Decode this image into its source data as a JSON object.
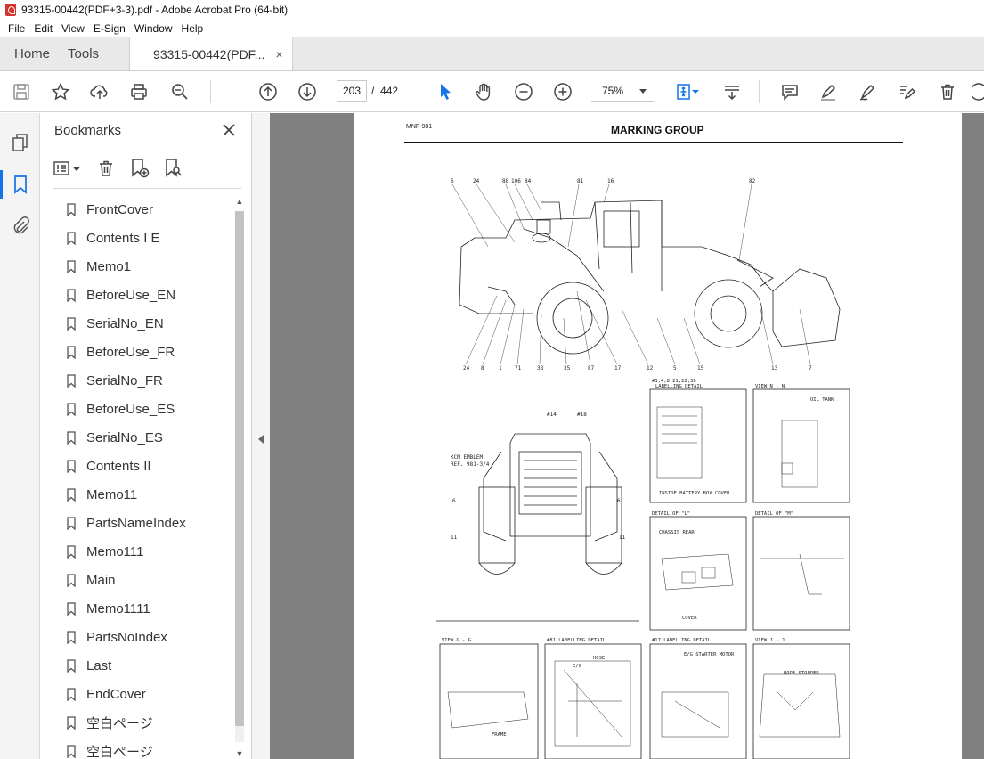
{
  "window": {
    "title": "93315-00442(PDF+3-3).pdf - Adobe Acrobat Pro (64-bit)"
  },
  "menu": [
    "File",
    "Edit",
    "View",
    "E-Sign",
    "Window",
    "Help"
  ],
  "tabs": {
    "home": "Home",
    "tools": "Tools",
    "document": "93315-00442(PDF...",
    "close": "×"
  },
  "toolbar": {
    "current_page": "203",
    "page_separator": "/",
    "total_pages": "442",
    "zoom": "75%"
  },
  "bookmarks": {
    "title": "Bookmarks",
    "items": [
      "FrontCover",
      "Contents I E",
      "Memo1",
      "BeforeUse_EN",
      "SerialNo_EN",
      "BeforeUse_FR",
      "SerialNo_FR",
      "BeforeUse_ES",
      "SerialNo_ES",
      "Contents II",
      "Memo11",
      "PartsNameIndex",
      "Memo111",
      "Main",
      "Memo1111",
      "PartsNoIndex",
      "Last",
      "EndCover",
      "空白ページ",
      "空白ページ"
    ]
  },
  "document": {
    "code": "MNF-981",
    "heading": "MARKING GROUP",
    "panels": {
      "labelling_a": "#3,4,8,21,22,36",
      "labelling_a2": "LABELLING DETAIL",
      "view_nn": "VIEW N - N",
      "detail_l": "DETAIL OF \"L\"",
      "detail_m": "DETAIL OF \"M\"",
      "view_gg": "VIEW G - G",
      "labelling_81": "#81 LABELLING DETAIL",
      "labelling_17": "#17 LABELLING DETAIL",
      "view_jj": "VIEW J - J",
      "battery_cover": "INSIDE BATTERY BOX COVER",
      "oil_tank": "OIL TANK",
      "chassis_rear": "CHASSIS REAR",
      "cover": "COVER",
      "frame": "FRAME",
      "hose": "HOSE",
      "eg": "E/G",
      "starter": "E/G STARTER MOTOR",
      "rope_stopper": "ROPE STOPPER",
      "emblem": "KCM EMBLEM",
      "emblem_ref": "REF. 981-3/4"
    }
  }
}
